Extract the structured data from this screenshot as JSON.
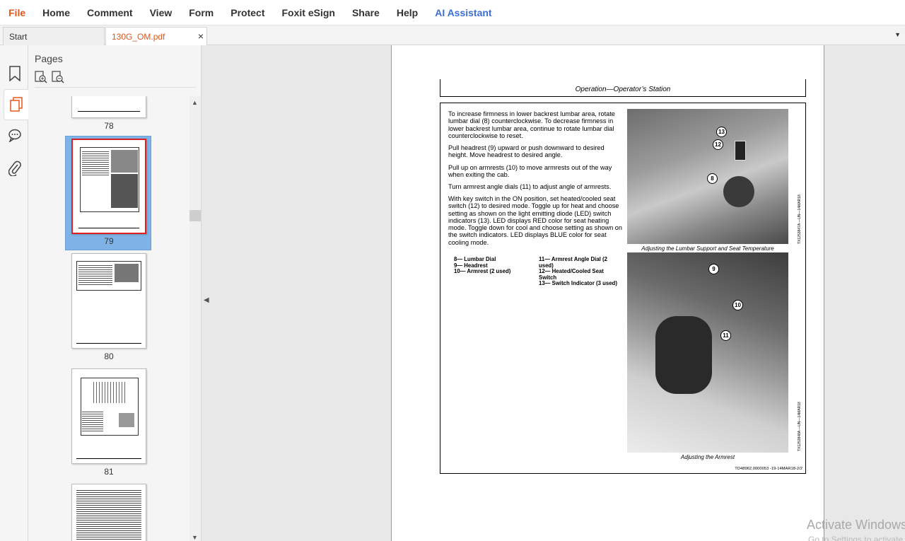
{
  "menu": {
    "items": [
      "File",
      "Home",
      "Comment",
      "View",
      "Form",
      "Protect",
      "Foxit eSign",
      "Share",
      "Help",
      "AI Assistant"
    ]
  },
  "tabs": {
    "start": "Start",
    "document": "130G_OM.pdf",
    "close": "×"
  },
  "pages_panel": {
    "title": "Pages",
    "thumbnails": [
      "78",
      "79",
      "80",
      "81"
    ]
  },
  "page": {
    "header": "Operation—Operator’s Station",
    "paragraphs": [
      "To increase firmness in lower backrest lumbar area, rotate lumbar dial (8) counterclockwise. To decrease firmness in lower backrest lumbar area, continue to rotate lumbar dial counterclockwise to reset.",
      "Pull headrest (9) upward or push downward to desired height. Move headrest to desired angle.",
      "Pull up on armrests (10) to move armrests out of the way when exiting the cab.",
      "Turn armrest angle dials (11) to adjust angle of armrests.",
      "With key switch in the ON position, set heated/cooled seat switch (12) to desired mode. Toggle up for heat and choose setting as shown on the light emitting diode (LED) switch indicators (13). LED displays RED color for seat heating mode. Toggle down for cool and choose setting as shown on the switch indicators. LED displays BLUE color for seat cooling mode."
    ],
    "legend_left": [
      "8— Lumbar Dial",
      "9— Headrest",
      "10— Armrest (2 used)"
    ],
    "legend_right": [
      "11— Armrest Angle Dial (2 used)",
      "12— Heated/Cooled Seat Switch",
      "13— Switch Indicator (3 used)"
    ],
    "caption_one": "Adjusting the Lumbar Support and Seat Temperature",
    "caption_two": "Adjusting the Armrest",
    "photo_one_code": "TX1253847A —UN—14MAR18",
    "photo_two_code": "TX1253848A —UN—14MAR18",
    "footer_code": "TD48962,0000053 -19-14MAR18-2/2",
    "callouts_one": [
      "13",
      "12",
      "8"
    ],
    "callouts_two": [
      "9",
      "10",
      "11"
    ]
  },
  "watermark": {
    "line1": "Activate Windows",
    "line2": "Go to Settings to activate Windows."
  },
  "colors": {
    "accent": "#e8571d",
    "ai": "#3c6fd6",
    "selection": "#7fb3e6"
  }
}
